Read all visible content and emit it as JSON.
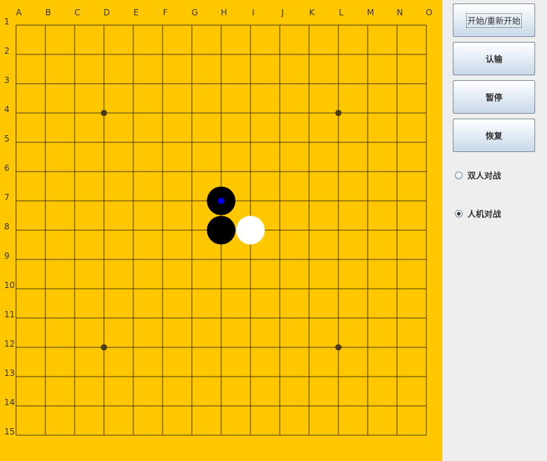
{
  "board": {
    "size": 15,
    "columns": [
      "A",
      "B",
      "C",
      "D",
      "E",
      "F",
      "G",
      "H",
      "I",
      "J",
      "K",
      "L",
      "M",
      "N",
      "O"
    ],
    "rows": [
      "1",
      "2",
      "3",
      "4",
      "5",
      "6",
      "7",
      "8",
      "9",
      "10",
      "11",
      "12",
      "13",
      "14",
      "15"
    ],
    "star_points": [
      [
        3,
        3
      ],
      [
        11,
        3
      ],
      [
        3,
        11
      ],
      [
        11,
        11
      ]
    ],
    "stones": [
      {
        "col": 7,
        "row": 6,
        "color": "black",
        "last_move": true
      },
      {
        "col": 7,
        "row": 7,
        "color": "black",
        "last_move": false
      },
      {
        "col": 8,
        "row": 7,
        "color": "white",
        "last_move": false
      }
    ],
    "colors": {
      "board": "#ffc700",
      "line": "#4a3a1a",
      "black_stone": "#000000",
      "white_stone": "#ffffff",
      "last_move_marker": "#0000ff"
    }
  },
  "panel": {
    "buttons": {
      "start_label": "开始/重新开始",
      "resign_label": "认输",
      "pause_label": "暂停",
      "resume_label": "恢复"
    },
    "modes": {
      "two_player_label": "双人对战",
      "vs_computer_label": "人机对战",
      "selected": "vs_computer"
    }
  }
}
